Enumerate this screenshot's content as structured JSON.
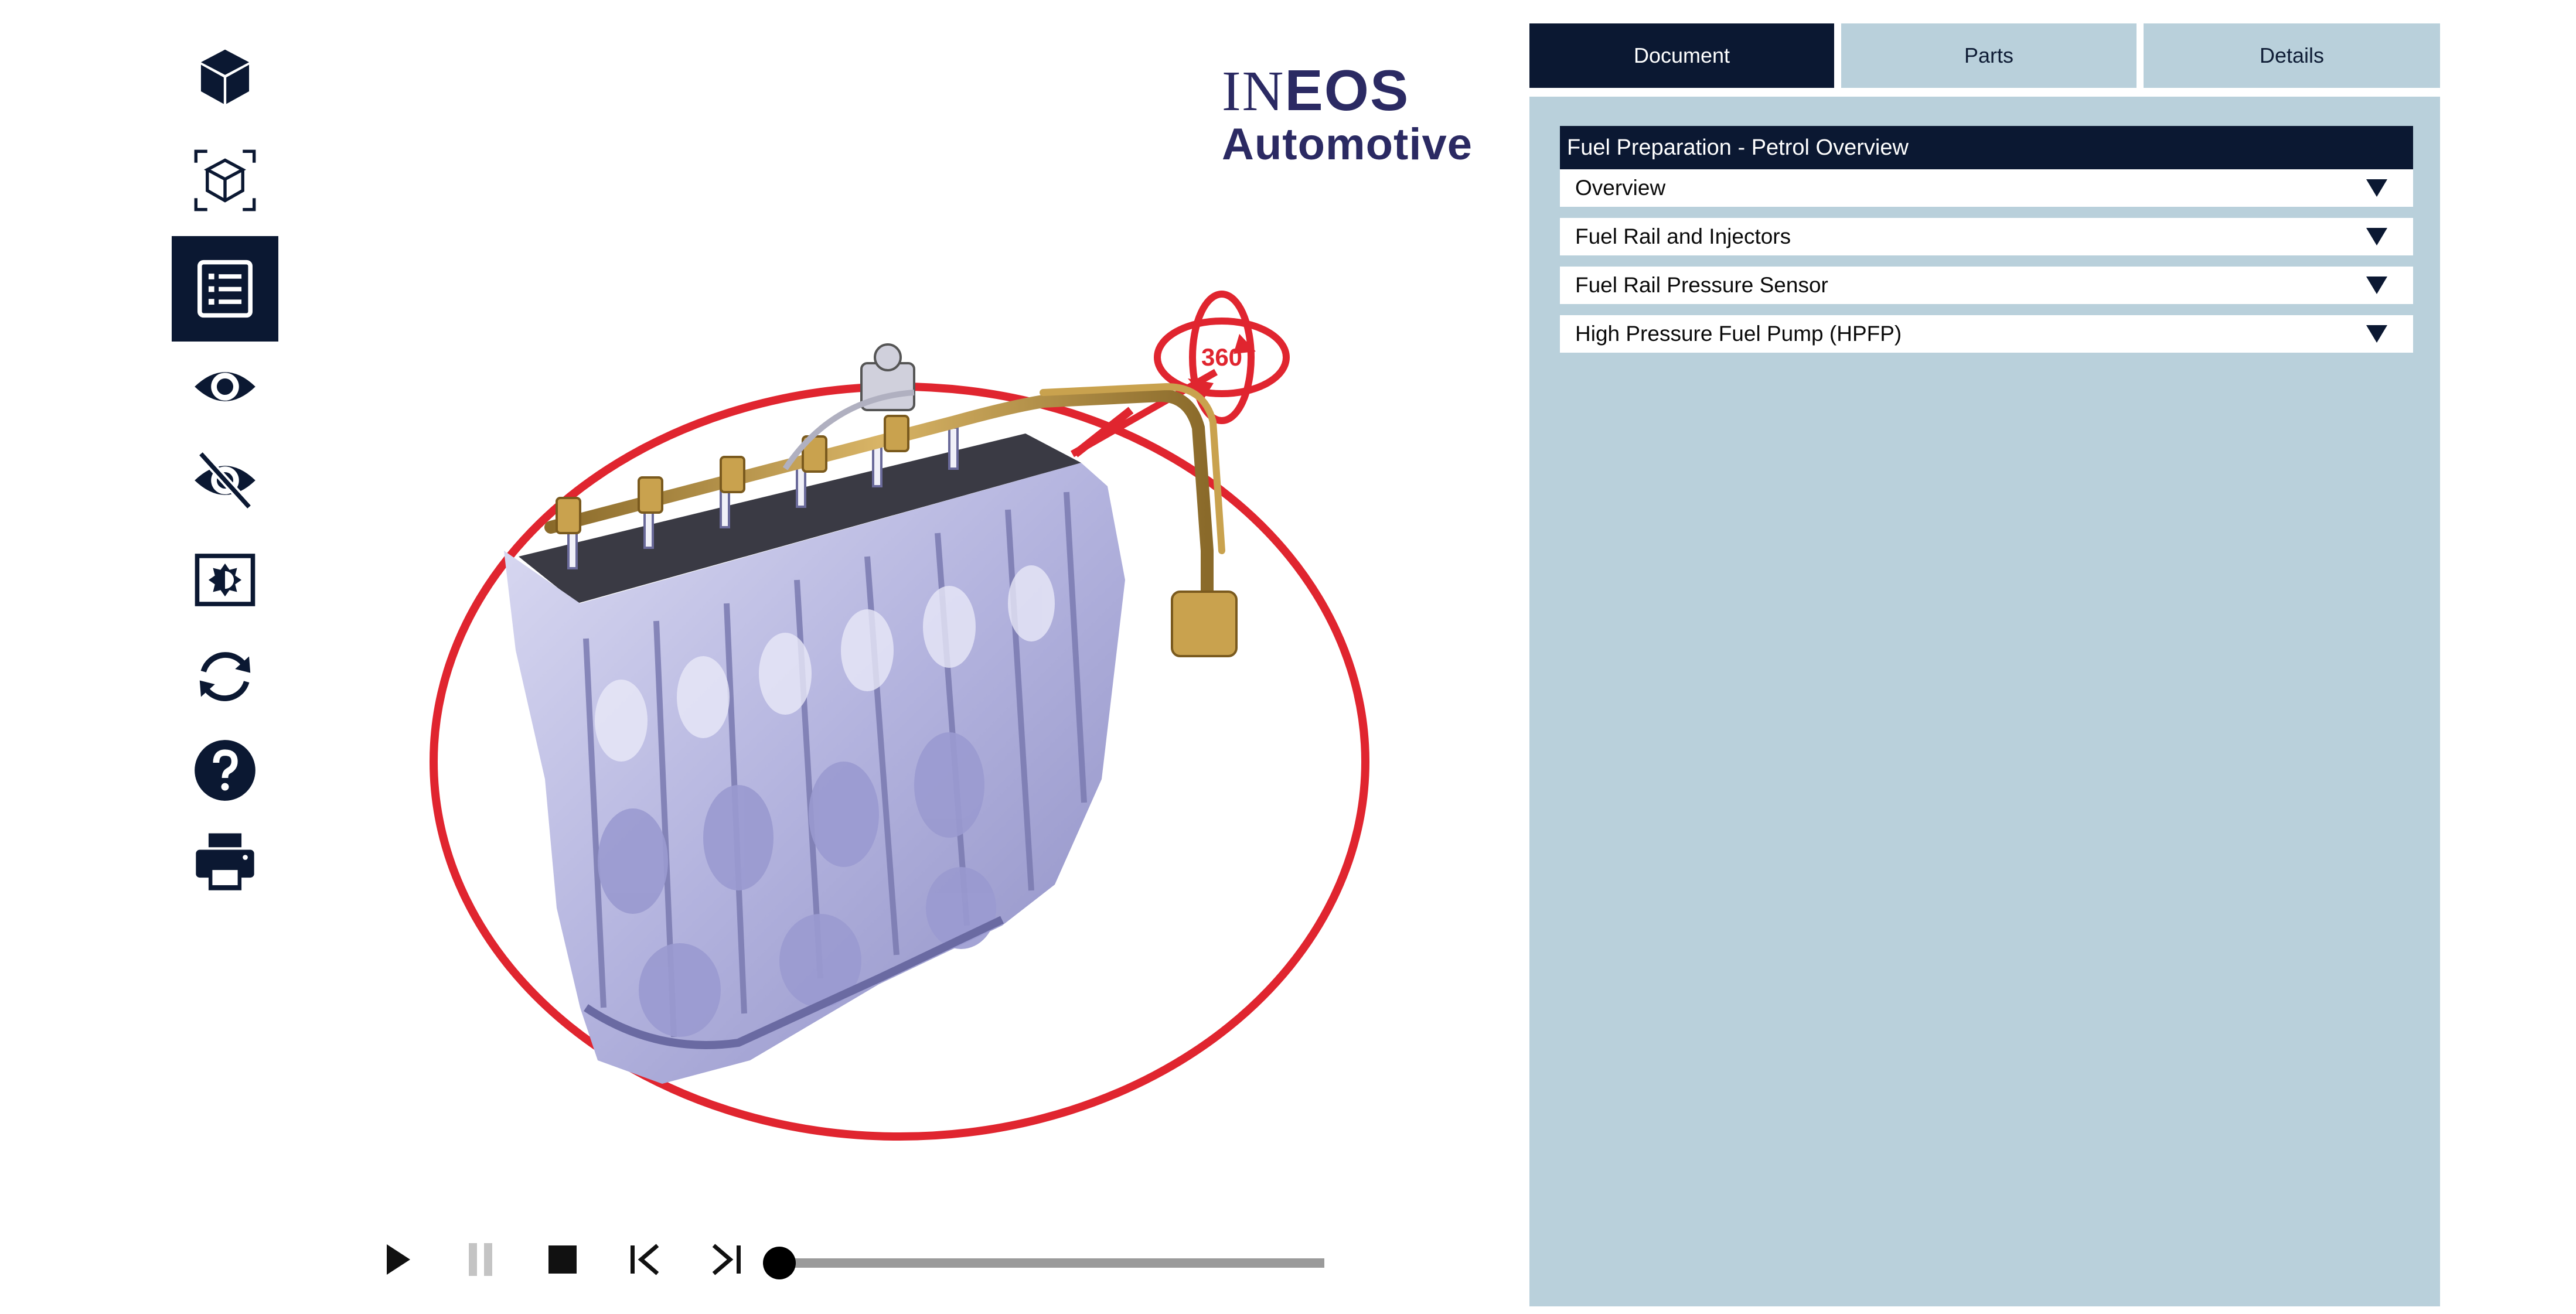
{
  "toolbar": {
    "tools": [
      {
        "icon": "cube-icon",
        "active": false
      },
      {
        "icon": "cube-focus-icon",
        "active": false
      },
      {
        "icon": "list-document-icon",
        "active": true
      },
      {
        "icon": "eye-icon",
        "active": false
      },
      {
        "icon": "eye-off-icon",
        "active": false
      },
      {
        "icon": "contrast-icon",
        "active": false
      },
      {
        "icon": "refresh-icon",
        "active": false
      },
      {
        "icon": "help-icon",
        "active": false
      },
      {
        "icon": "print-icon",
        "active": false
      }
    ]
  },
  "logo": {
    "line1_a": "IN",
    "line1_b": "EOS",
    "line2": "Automotive"
  },
  "viewer": {
    "badge_360": "360",
    "annotation_color": "#e0252f"
  },
  "playback": {
    "buttons": [
      "play-icon",
      "pause-icon",
      "stop-icon",
      "skip-back-icon",
      "skip-forward-icon"
    ],
    "pause_disabled": true,
    "progress": 0
  },
  "tabs": {
    "document": "Document",
    "parts": "Parts",
    "details": "Details",
    "active": "Document"
  },
  "document": {
    "title": "Fuel Preparation - Petrol Overview",
    "sections": [
      {
        "label": "Overview"
      },
      {
        "label": "Fuel Rail and Injectors"
      },
      {
        "label": "Fuel Rail Pressure Sensor"
      },
      {
        "label": "High Pressure Fuel Pump (HPFP)"
      }
    ]
  },
  "colors": {
    "navy": "#0b1832",
    "panel": "#b9d0db",
    "logo": "#2b2a63",
    "red": "#e0252f"
  }
}
